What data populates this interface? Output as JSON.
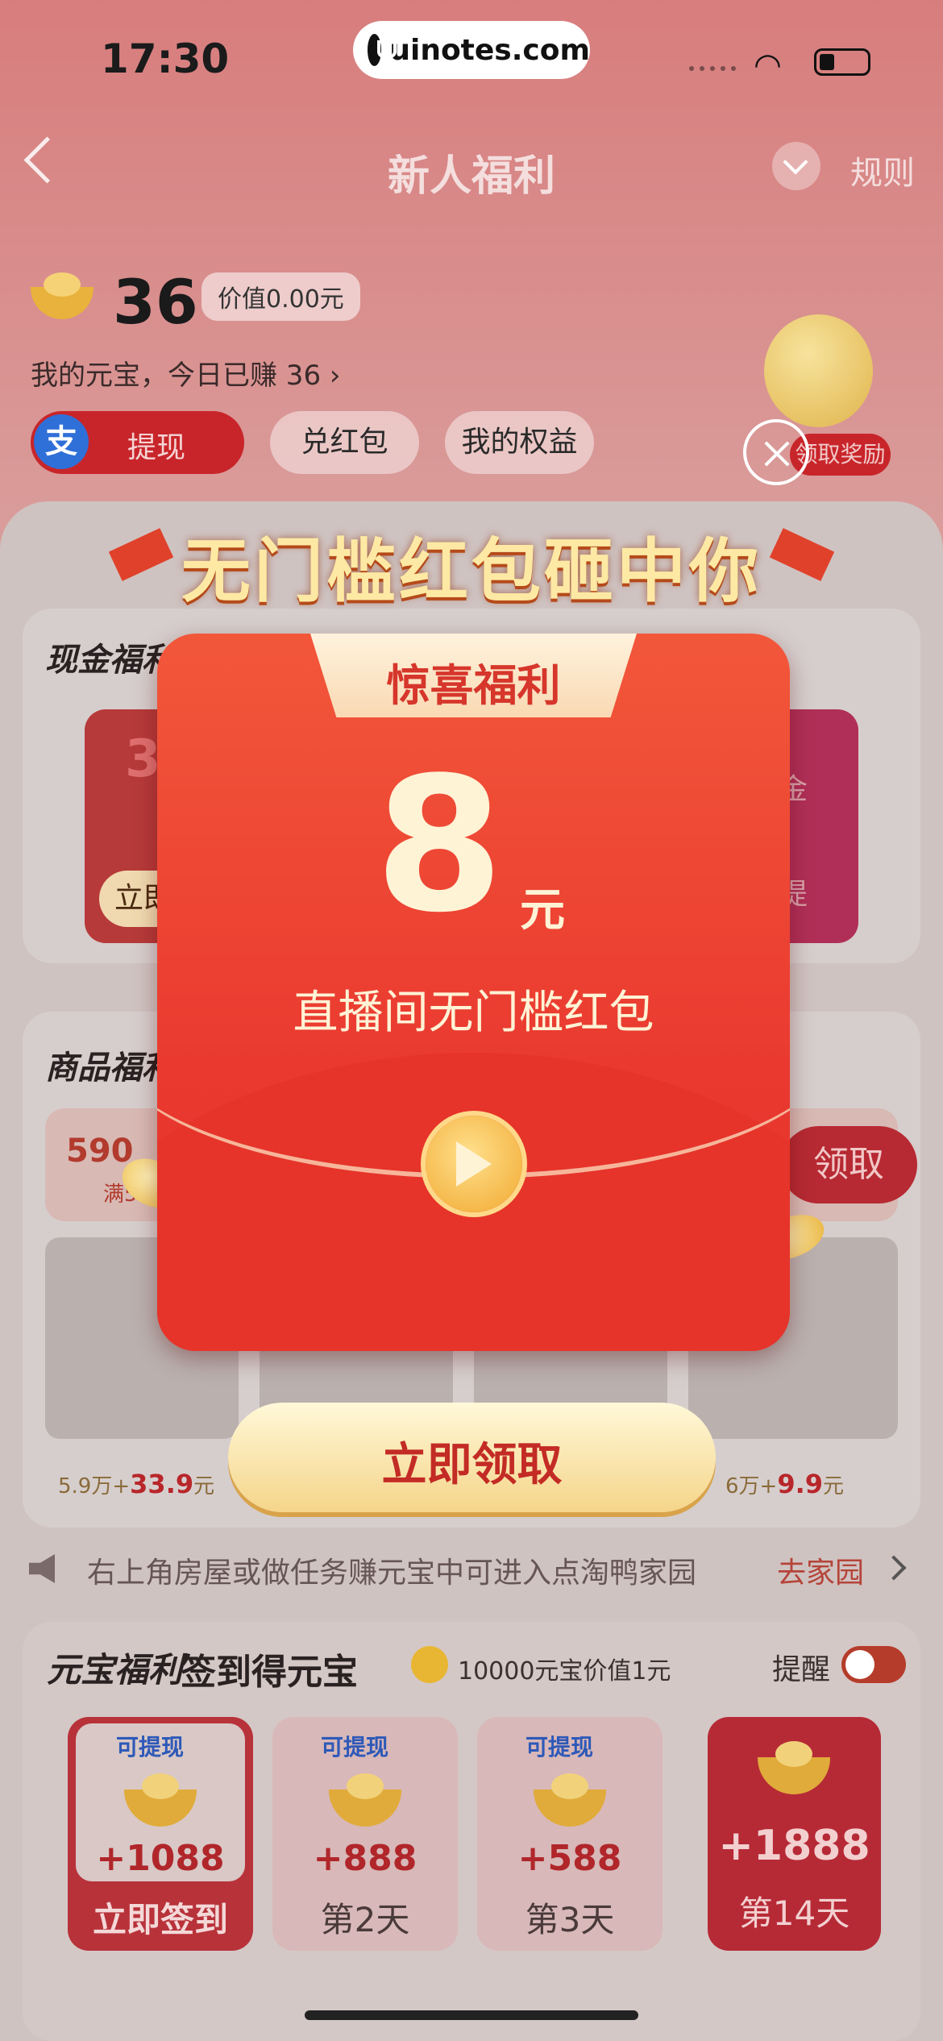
{
  "status_bar": {
    "time": "17:30",
    "watermark": "uinotes.com"
  },
  "nav": {
    "title": "新人福利",
    "rules": "规则"
  },
  "account": {
    "coins": "36",
    "worth": "价值0.00元",
    "earned_today": "我的元宝，今日已赚 36 ›"
  },
  "actions": {
    "alipay_icon": "支",
    "withdraw": "提现",
    "redeem": "兑红包",
    "rights": "我的权益"
  },
  "mascot_badge": "领取奖励",
  "cash_section": {
    "title": "现金福利",
    "left_value": "3",
    "left_button": "立即",
    "right_text_top": "金",
    "right_text_bottom": "提"
  },
  "goods_section": {
    "title": "商品福利",
    "coupon_value": "590",
    "coupon_sub": "满5",
    "claim_button": "领取",
    "left_price": {
      "coins": "5.9",
      "unit": "万+",
      "cash": "33.9",
      "yuan": "元"
    },
    "right_price": {
      "coins": "6",
      "unit": "万+",
      "cash": "9.9",
      "yuan": "元"
    }
  },
  "notice": {
    "text": "右上角房屋或做任务赚元宝中可进入点淘鸭家园",
    "link": "去家园"
  },
  "checkin": {
    "title": "元宝福利",
    "subtitle": "签到得元宝",
    "note": "10000元宝价值1元",
    "remind": "提醒",
    "days": [
      {
        "tag": "可提现",
        "amount": "+1088",
        "label": "立即签到"
      },
      {
        "tag": "可提现",
        "amount": "+888",
        "label": "第2天"
      },
      {
        "tag": "可提现",
        "amount": "+588",
        "label": "第3天"
      },
      {
        "amount": "+1888",
        "label": "第14天"
      }
    ]
  },
  "popup": {
    "banner": "无门槛红包砸中你",
    "tab": "惊喜福利",
    "amount": "8",
    "unit": "元",
    "desc": "直播间无门槛红包",
    "claim": "立即领取"
  }
}
